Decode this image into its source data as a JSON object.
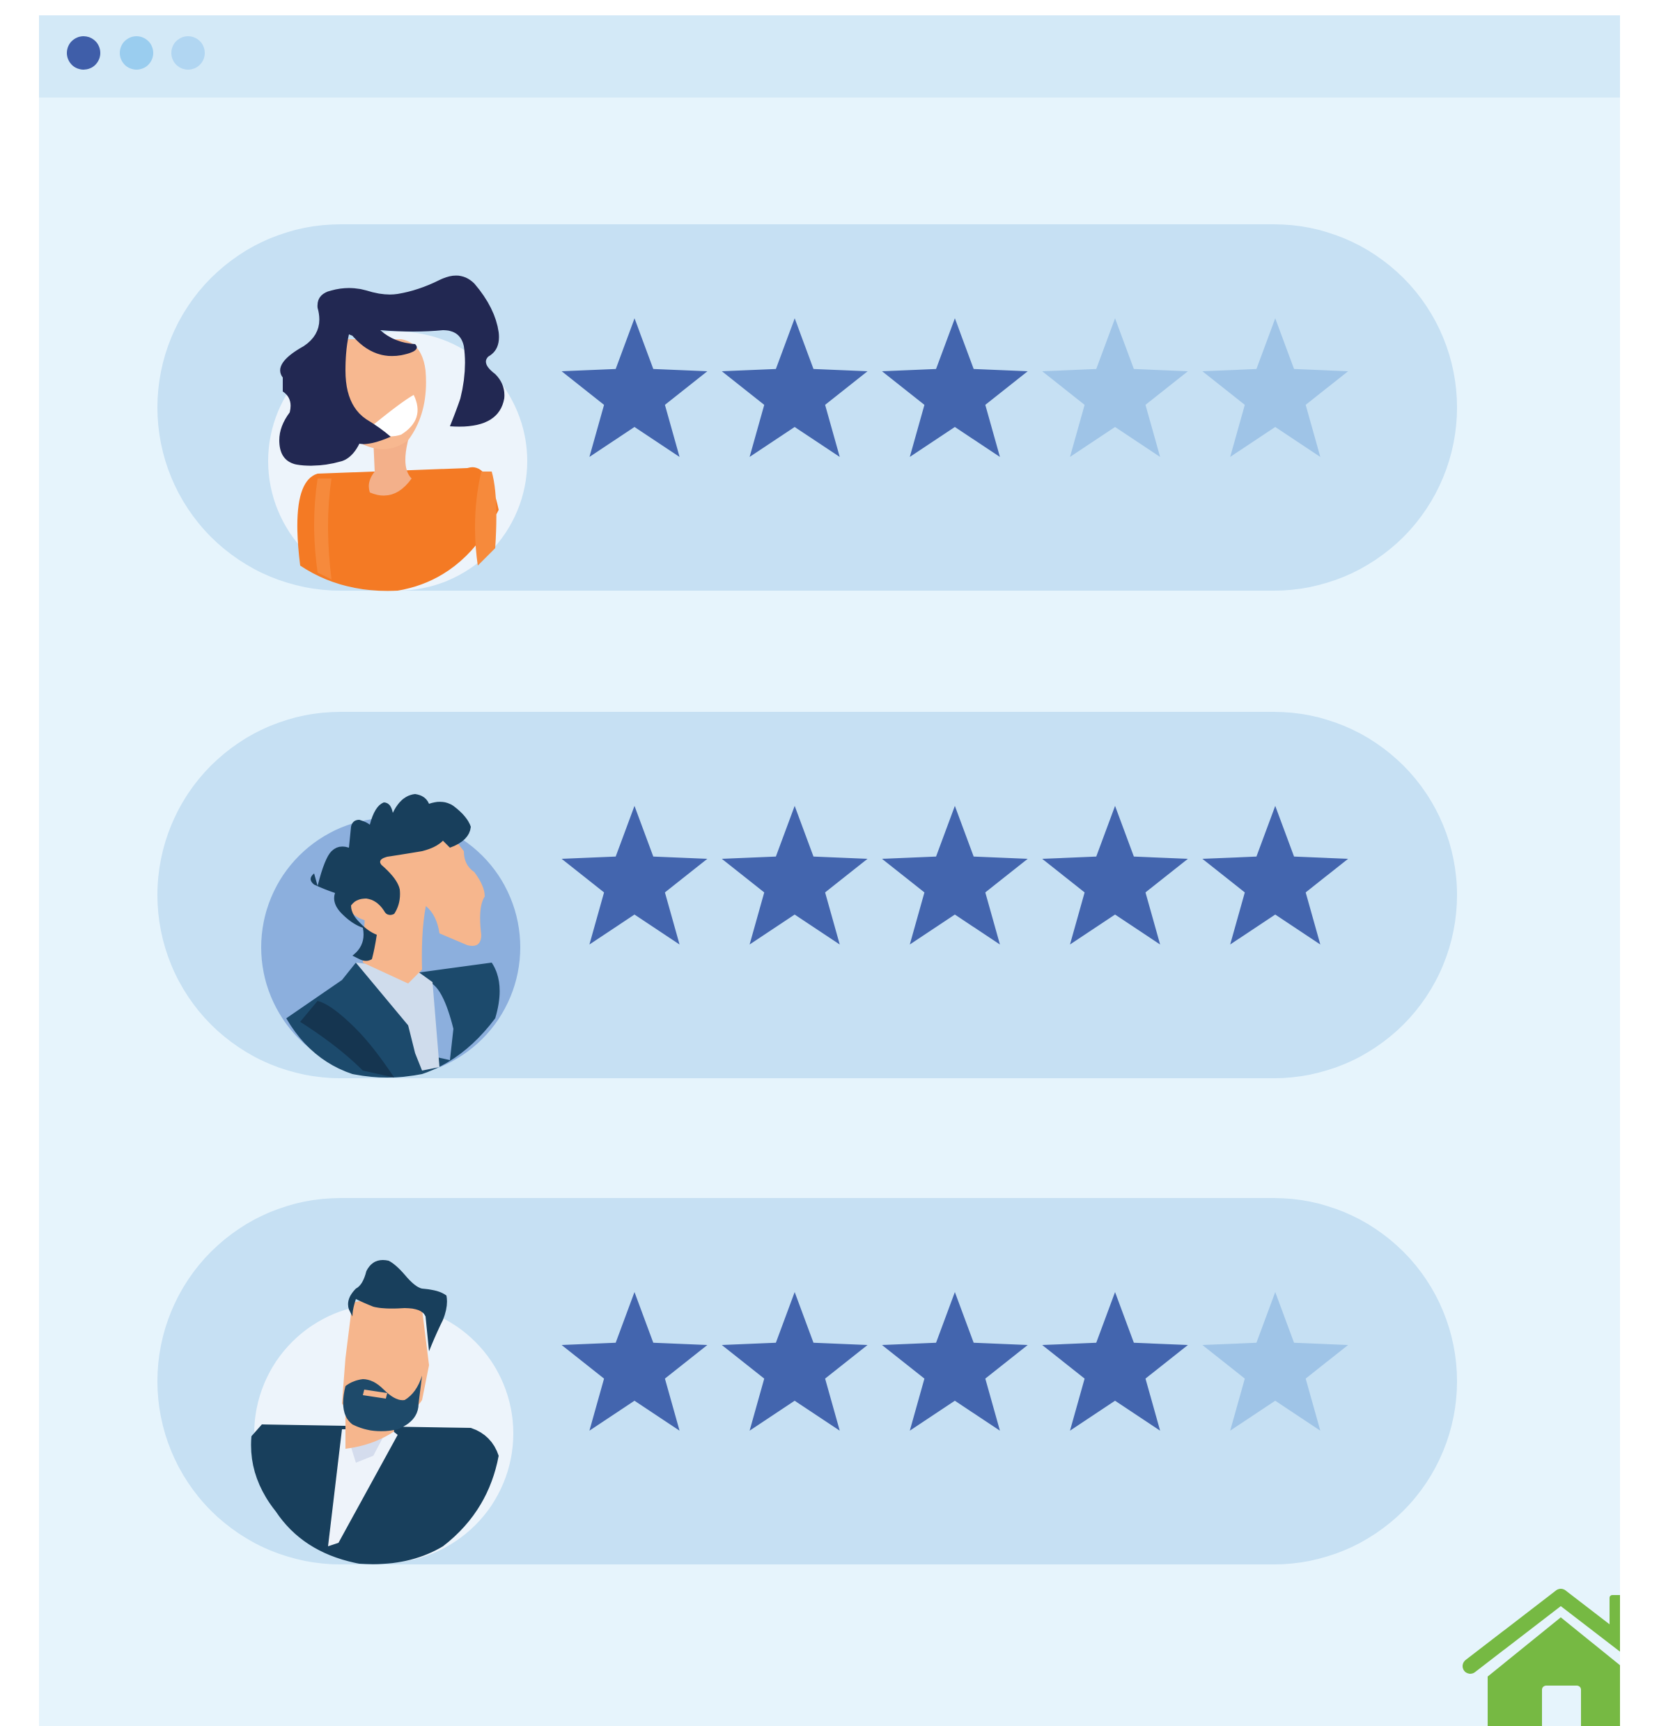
{
  "window": {
    "controls": [
      {
        "name": "close",
        "color": "#3f5ea9"
      },
      {
        "name": "minimize",
        "color": "#9acdef"
      },
      {
        "name": "maximize",
        "color": "#b1d6f2"
      }
    ]
  },
  "colors": {
    "star_filled": "#4365ae",
    "star_empty": "#9fc4e7",
    "card": "#c6e0f3",
    "background": "#e6f4fc",
    "logo": "#76b943"
  },
  "reviews": [
    {
      "reviewer": "woman-avatar",
      "rating": 3,
      "max": 5
    },
    {
      "reviewer": "young-man-avatar",
      "rating": 5,
      "max": 5
    },
    {
      "reviewer": "bearded-man-avatar",
      "rating": 4,
      "max": 5
    }
  ],
  "logo": {
    "icon": "house-icon"
  }
}
